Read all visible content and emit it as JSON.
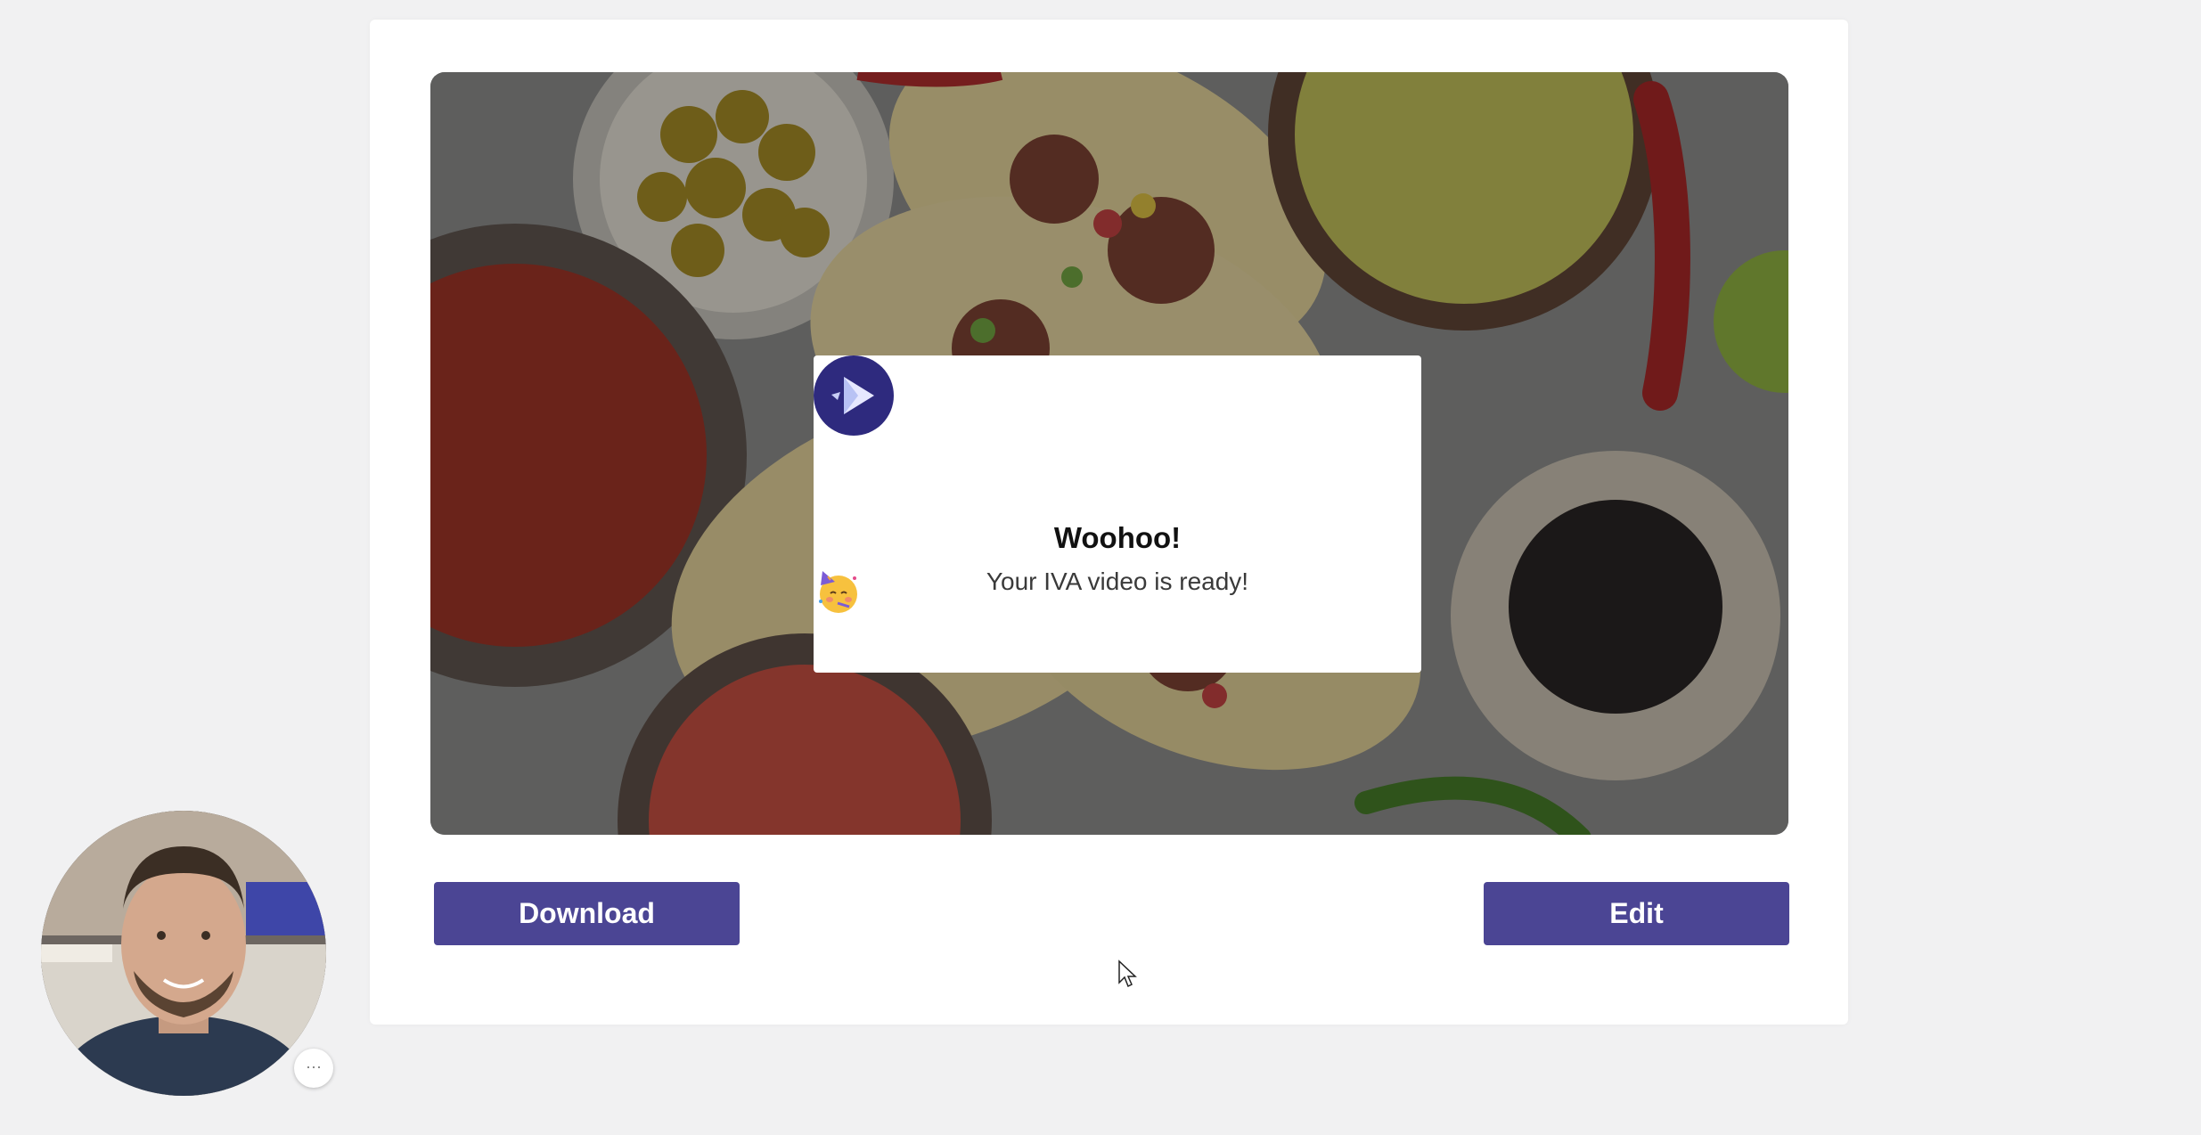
{
  "modal": {
    "title": "Woohoo!",
    "subtitle": "Your IVA video is ready!",
    "emoji": "partying-face-emoji",
    "logo_icon": "play-logo-icon"
  },
  "actions": {
    "download_label": "Download",
    "edit_label": "Edit"
  },
  "webcam": {
    "more_label": "···"
  },
  "colors": {
    "page_bg": "#f1f1f2",
    "card_bg": "#ffffff",
    "button_bg": "#4b4594",
    "logo_bg": "#2e2a7e"
  }
}
